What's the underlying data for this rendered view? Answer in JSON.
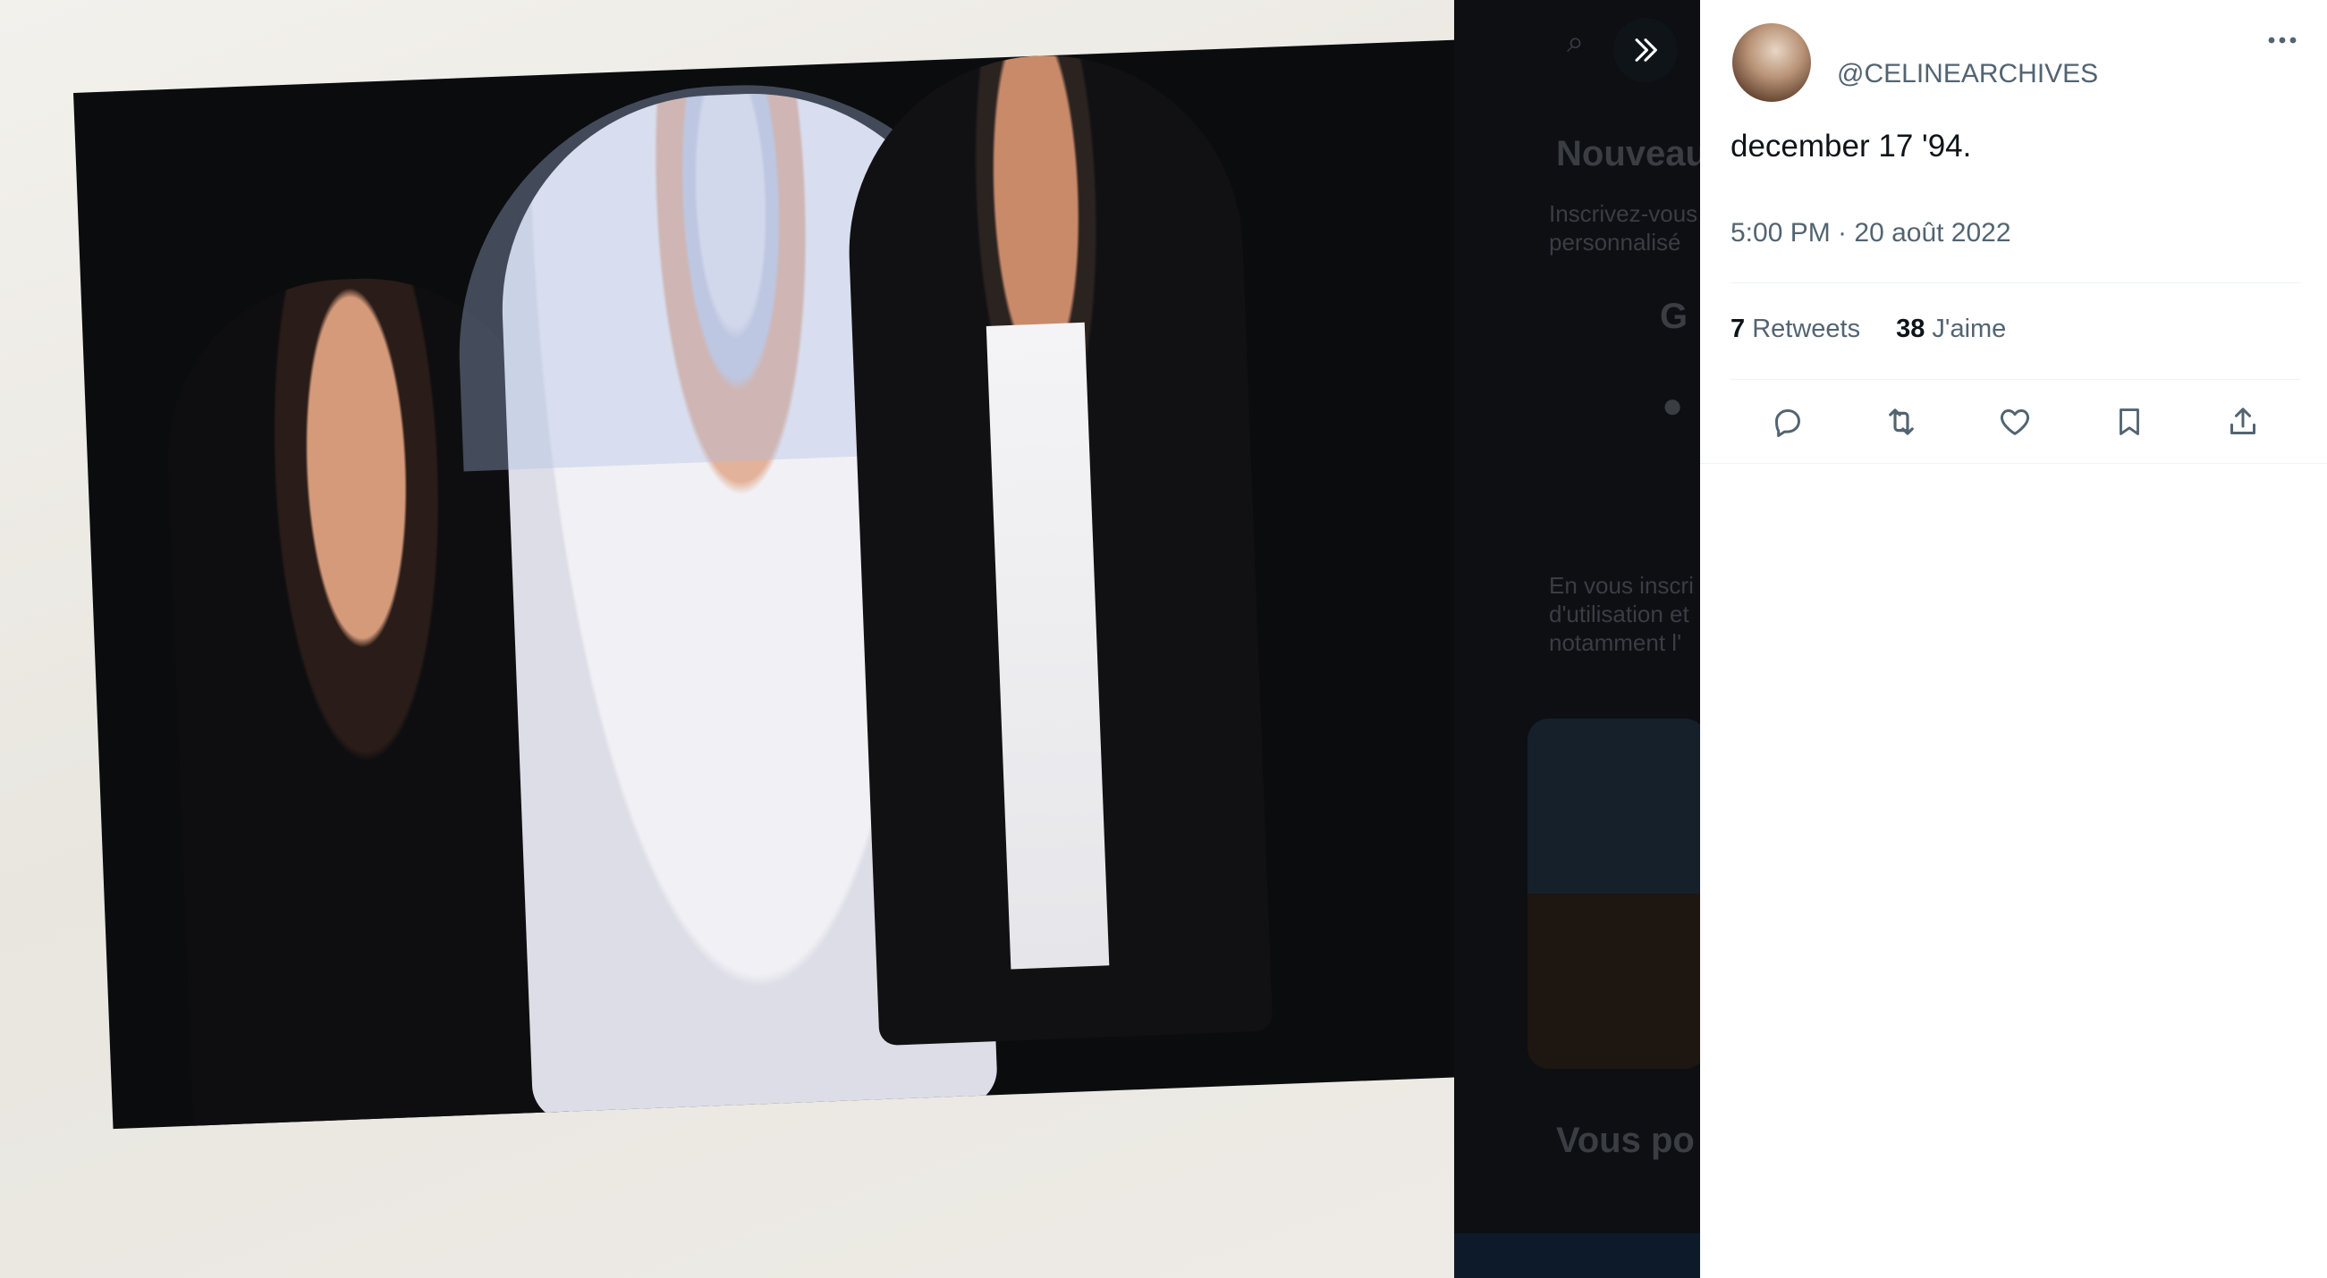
{
  "tweet": {
    "handle": "@CELINEARCHIVES",
    "text": "december 17 '94.",
    "time": "5:00 PM · 20 août 2022",
    "retweets_count": "7",
    "retweets_label": "Retweets",
    "likes_count": "38",
    "likes_label": "J'aime"
  },
  "background_page": {
    "heading": "Nouveau",
    "signup_text_1": "Inscrivez-vous",
    "signup_text_2": "personnalisé",
    "legal_1": "En vous inscri",
    "legal_2": "d'utilisation et",
    "legal_3": "notamment l'",
    "section_heading": "Vous po"
  },
  "icons": {
    "expand": "double-chevron-right-icon",
    "more": "more-dots-icon",
    "reply": "reply-icon",
    "retweet": "retweet-icon",
    "like": "heart-icon",
    "bookmark": "bookmark-icon",
    "share": "share-icon"
  },
  "colors": {
    "text_primary": "#0f1419",
    "text_secondary": "#536471",
    "divider": "#eff3f4"
  }
}
